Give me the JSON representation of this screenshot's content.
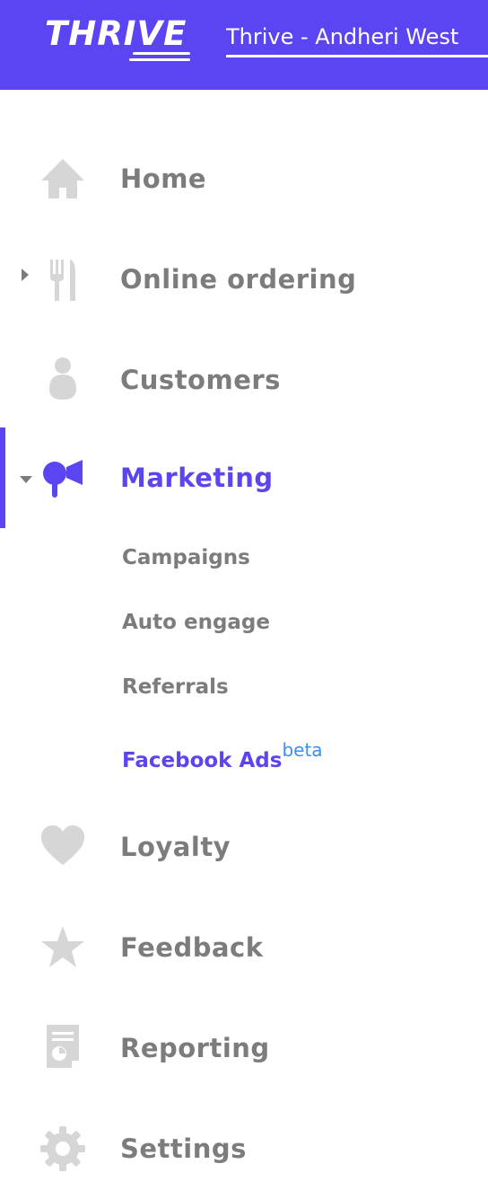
{
  "brand": {
    "logo_text": "THRIVE",
    "outlet_name": "Thrive - Andheri West"
  },
  "nav": {
    "home": "Home",
    "online_ordering": "Online ordering",
    "customers": "Customers",
    "marketing": "Marketing",
    "loyalty": "Loyalty",
    "feedback": "Feedback",
    "reporting": "Reporting",
    "settings": "Settings"
  },
  "marketing_sub": {
    "campaigns": "Campaigns",
    "auto_engage": "Auto engage",
    "referrals": "Referrals",
    "facebook_ads": "Facebook Ads",
    "facebook_ads_badge": "beta"
  },
  "colors": {
    "accent": "#5b44f2",
    "text_muted": "#7c7c7c",
    "icon_gray": "#d6d6d6",
    "beta_blue": "#3b8ff0"
  }
}
